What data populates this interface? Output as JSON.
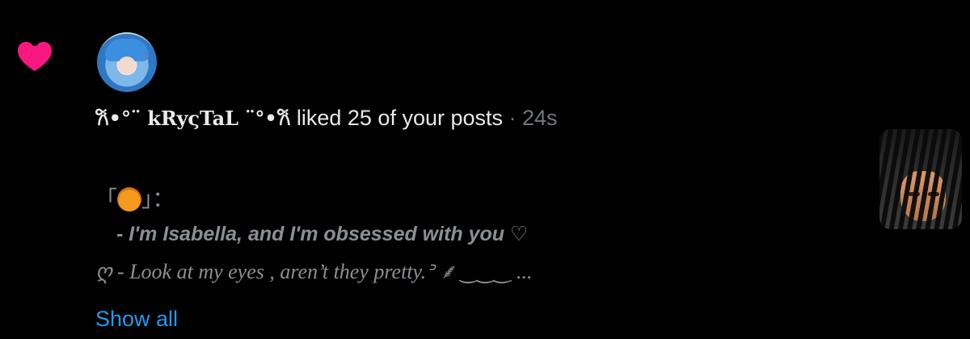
{
  "notification": {
    "actor_name": "𐙚•°¨ kRyςTaL ¨°•𐙚",
    "action_text": " liked 25 of your posts",
    "separator": " · ",
    "time": "24s",
    "heart_color": "#f91880"
  },
  "post_preview": {
    "line1_open": "「",
    "line1_close": "」：",
    "line2": "- I'm Isabella, and I'm obsessed with you ♡",
    "line3": "ღ - Look at my eyes , aren’t they pretty.ᐣ ⸙ ‿‿‿ ..."
  },
  "show_all_label": "Show all",
  "accent_color": "#1d9bf0"
}
